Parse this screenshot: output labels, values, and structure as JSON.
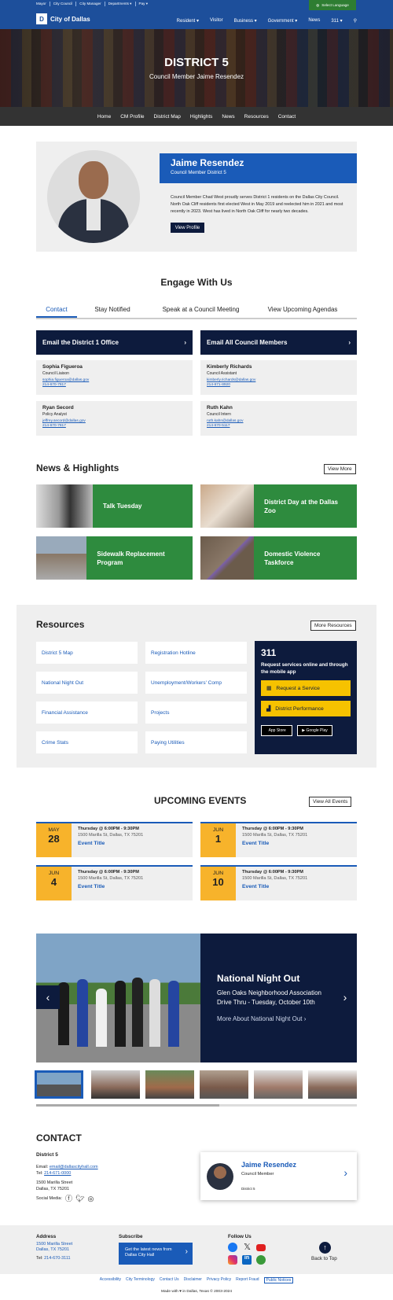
{
  "top_links": [
    "Mayor",
    "City Council",
    "City Manager",
    "Departments ▾",
    "Pay ▾"
  ],
  "language_button": "Select Language",
  "logo_text": "City of Dallas",
  "main_nav": [
    "Resident ▾",
    "Visitor",
    "Business ▾",
    "Government ▾",
    "News",
    "311 ▾"
  ],
  "hero": {
    "title": "DISTRICT 5",
    "subtitle": "Council Member Jaime Resendez"
  },
  "sub_nav": [
    "Home",
    "CM Profile",
    "District Map",
    "Highlights",
    "News",
    "Resources",
    "Contact"
  ],
  "profile": {
    "name": "Jaime Resendez",
    "role": "Council Member District 5",
    "bio": "Council Member Chad West proudly serves District 1 residents on the Dallas City Council. North Oak Cliff residents first elected West in May 2019 and reelected him in 2021 and most recently in 2023. West has lived in North Oak Cliff for nearly two decades.",
    "button": "View Profile"
  },
  "engage": {
    "title": "Engage With Us",
    "tabs": [
      "Contact",
      "Stay Notified",
      "Speak at a Council Meeting",
      "View Upcoming Agendas"
    ],
    "email_office": "Email the District 1 Office",
    "email_all": "Email All Council Members",
    "contacts": [
      {
        "name": "Sophia Figueroa",
        "role": "Council Liaison",
        "email": "sophia.figueroa@dallas.gov",
        "phone": "214-670-7817"
      },
      {
        "name": "Kimberly Richards",
        "role": "Council Assistant",
        "email": "kimberly.richards@dallas.gov",
        "phone": "214-671-8920"
      },
      {
        "name": "Ryan Secord",
        "role": "Policy Analyst",
        "email": "jeffrey.secord@dallas.gov",
        "phone": "214-670-7817"
      },
      {
        "name": "Ruth Kahn",
        "role": "Council Intern",
        "email": "ruth.kahn@dallas.gov",
        "phone": "214-670-5117"
      }
    ]
  },
  "news": {
    "title": "News & Highlights",
    "button": "View More",
    "items": [
      "Talk Tuesday",
      "District Day at the Dallas Zoo",
      "Sidewalk Replacement Program",
      "Domestic Violence Taskforce"
    ]
  },
  "resources": {
    "title": "Resources",
    "button": "More Resources",
    "links": [
      "District 5 Map",
      "Registration Hotline",
      "National Night Out",
      "Unemployment/Workers' Comp",
      "Financial Assistance",
      "Projects",
      "Crime Stats",
      "Paying Utilities"
    ],
    "box311": {
      "title": "311",
      "text": "Request services online and through the mobile app",
      "btn1": "Request a Service",
      "btn2": "District Performance",
      "app_store": "App Store",
      "google_play": "Google Play"
    }
  },
  "events": {
    "title": "UPCOMING EVENTS",
    "button": "View All Events",
    "items": [
      {
        "month": "MAY",
        "day": "28",
        "time": "Thursday @ 6:00PM - 9:30PM",
        "address": "1500 Marilla St, Dallas, TX 75201",
        "title": "Event Title"
      },
      {
        "month": "JUN",
        "day": "1",
        "time": "Thursday @ 6:00PM - 9:30PM",
        "address": "1500 Marilla St, Dallas, TX 75201",
        "title": "Event Title"
      },
      {
        "month": "JUN",
        "day": "4",
        "time": "Thursday @ 6:00PM - 9:30PM",
        "address": "1500 Marilla St, Dallas, TX 75201",
        "title": "Event Title"
      },
      {
        "month": "JUN",
        "day": "10",
        "time": "Thursday @ 6:00PM - 9:30PM",
        "address": "1500 Marilla St, Dallas, TX 75201",
        "title": "Event Title"
      }
    ]
  },
  "slider": {
    "title": "National Night Out",
    "desc": "Glen Oaks Neighborhood Association Drive Thru - Tuesday, October 10th",
    "link": "More About National Night Out ›"
  },
  "contact": {
    "title": "CONTACT",
    "district": "District 5",
    "email_label": "Email:",
    "email": "email@dallascityhall.com",
    "tel_label": "Tel:",
    "tel": "214-671-0000",
    "addr1": "1500 Marilla Street",
    "addr2": "Dallas, TX 75201",
    "social": "Social Media:",
    "card_name": "Jaime Resendez",
    "card_role": "Council Member",
    "card_district": "District 5"
  },
  "footer": {
    "address_title": "Address",
    "addr1": "1500 Marilla Street",
    "addr2": "Dallas, TX 75201",
    "tel_label": "Tel:",
    "tel": "214-670-3111",
    "subscribe_title": "Subscribe",
    "subscribe_btn": "Get the latest news from Dallas City Hall",
    "follow_title": "Follow Us",
    "back_top": "Back to Top",
    "links": [
      "Accessibility",
      "City Terminology",
      "Contact Us",
      "Disclaimer",
      "Privacy Policy",
      "Report Fraud",
      "Public Notices"
    ],
    "made": "Made with ♥ in Dallas, Texas © 2003-2024"
  }
}
